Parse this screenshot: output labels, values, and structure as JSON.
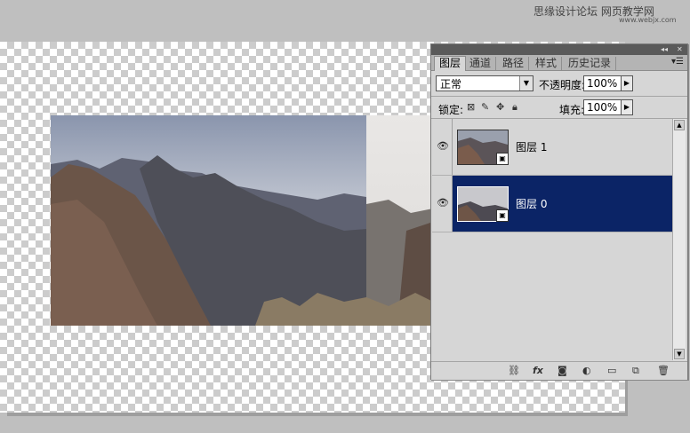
{
  "watermark": {
    "site": "思缘设计论坛",
    "brand": "网页教学网",
    "url": "www.webjx.com"
  },
  "panel": {
    "tabs": [
      {
        "label": "图层",
        "active": true
      },
      {
        "label": "通道",
        "active": false
      },
      {
        "label": "路径",
        "active": false
      },
      {
        "label": "样式",
        "active": false
      },
      {
        "label": "历史记录",
        "active": false
      }
    ],
    "blend_mode": "正常",
    "opacity_label": "不透明度:",
    "opacity_value": "100%",
    "lock_label": "锁定:",
    "fill_label": "填充:",
    "fill_value": "100%",
    "layers": [
      {
        "name": "图层 1",
        "visible": true,
        "selected": false
      },
      {
        "name": "图层 0",
        "visible": true,
        "selected": true
      }
    ],
    "accent_color": "#0b2466",
    "icons": [
      "link-icon",
      "fx-icon",
      "mask-icon",
      "adjustment-icon",
      "folder-icon",
      "new-layer-icon",
      "trash-icon"
    ]
  }
}
